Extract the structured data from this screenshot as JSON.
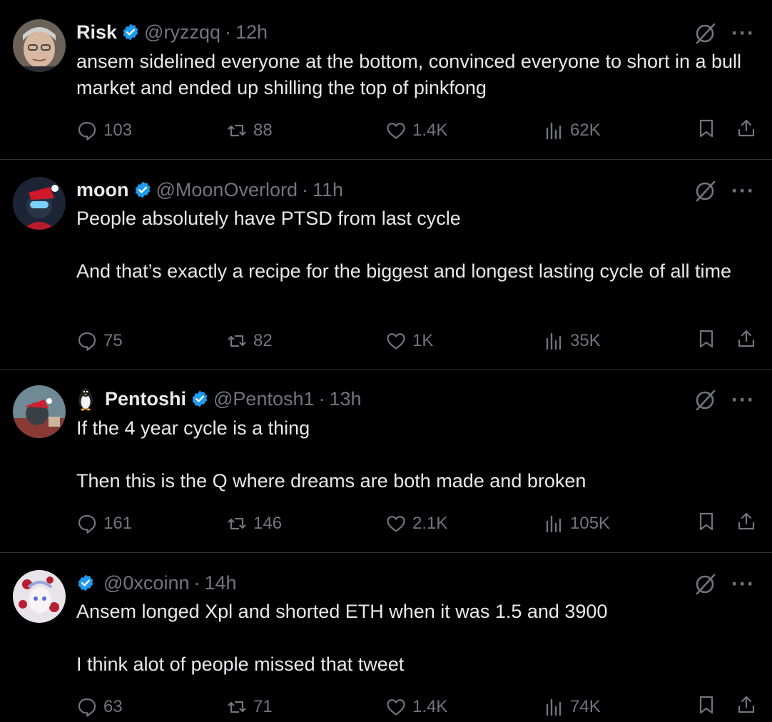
{
  "tweets": [
    {
      "name": "Risk",
      "handle": "@ryzzqq",
      "time": "12h",
      "text": [
        "ansem sidelined everyone at the bottom, convinced everyone to short in a bull market and ended up shilling the top of pinkfong"
      ],
      "replies": "103",
      "retweets": "88",
      "likes": "1.4K",
      "views": "62K"
    },
    {
      "name": "moon",
      "handle": "@MoonOverlord",
      "time": "11h",
      "text": [
        "People absolutely have PTSD from last cycle",
        "And that’s exactly a recipe for the biggest and longest lasting cycle of all time"
      ],
      "replies": "75",
      "retweets": "82",
      "likes": "1K",
      "views": "35K"
    },
    {
      "name": "Pentoshi",
      "handle": "@Pentosh1",
      "time": "13h",
      "text": [
        "If the 4 year cycle is a thing",
        "Then this is the Q where dreams are both made and broken"
      ],
      "replies": "161",
      "retweets": "146",
      "likes": "2.1K",
      "views": "105K"
    },
    {
      "name": "",
      "handle": "@0xcoinn",
      "time": "14h",
      "text": [
        "Ansem longed Xpl and shorted ETH when it was 1.5 and 3900",
        "I think alot of people missed that tweet"
      ],
      "replies": "63",
      "retweets": "71",
      "likes": "1.4K",
      "views": "74K"
    }
  ],
  "ui": {
    "separator": "·",
    "more_glyph": "···"
  },
  "colors": {
    "background": "#000000",
    "text": "#e7e9ea",
    "muted": "#71767b",
    "verified": "#1d9bf0",
    "divider": "#2f3336"
  }
}
